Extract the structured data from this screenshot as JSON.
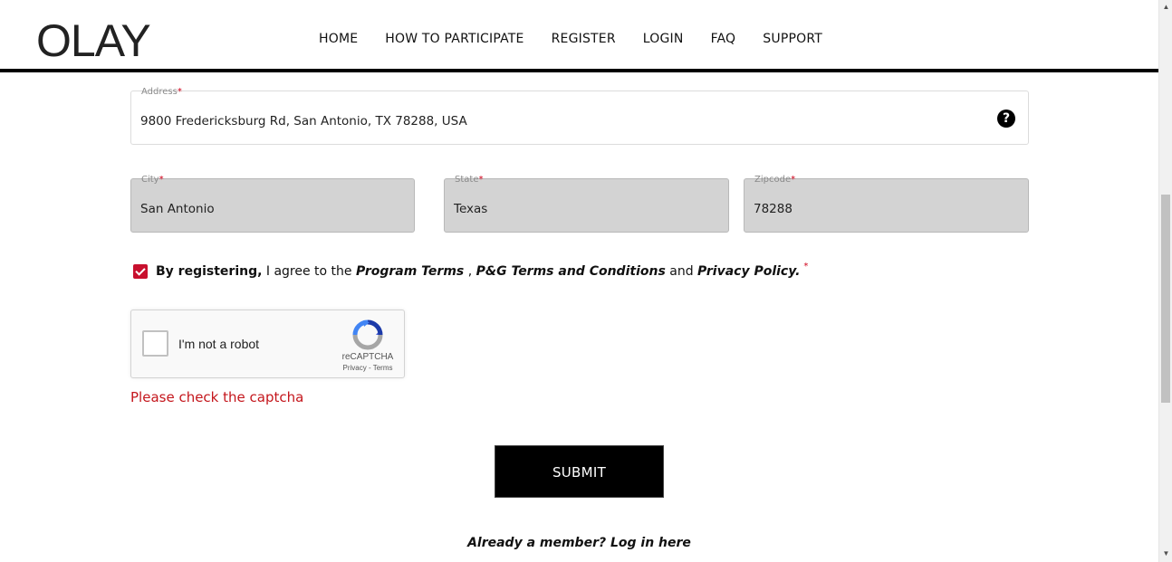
{
  "header": {
    "logo": "OLAY",
    "nav": [
      "HOME",
      "HOW TO PARTICIPATE",
      "REGISTER",
      "LOGIN",
      "FAQ",
      "SUPPORT"
    ]
  },
  "form": {
    "address": {
      "label": "Address",
      "value": "9800 Fredericksburg Rd, San Antonio, TX 78288, USA",
      "help_icon": "?"
    },
    "city": {
      "label": "City",
      "value": "San Antonio"
    },
    "state": {
      "label": "State",
      "value": "Texas"
    },
    "zipcode": {
      "label": "Zipcode",
      "value": "78288"
    },
    "required_mark": "*",
    "terms": {
      "lead_bold": "By registering,",
      "lead_text": " I agree to the ",
      "program_terms": "Program Terms",
      "comma": " , ",
      "pg_terms": "P&G Terms and Conditions",
      "and": " and ",
      "privacy": "Privacy Policy.",
      "checked": true
    },
    "captcha": {
      "label": "I'm not a robot",
      "brand": "reCAPTCHA",
      "links": "Privacy - Terms"
    },
    "error": "Please check the captcha",
    "submit_label": "SUBMIT",
    "login_prompt": "Already a member? Log in here"
  },
  "colors": {
    "accent_red": "#c8102e",
    "error_red": "#c4161c",
    "button_bg": "#000000",
    "field_disabled": "#d3d3d3"
  }
}
